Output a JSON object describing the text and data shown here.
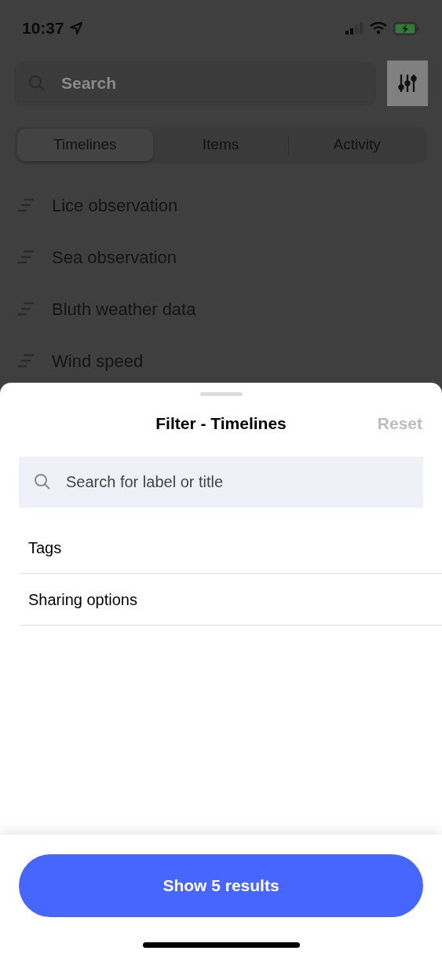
{
  "status_bar": {
    "time": "10:37"
  },
  "search": {
    "placeholder": "Search"
  },
  "tabs": [
    {
      "label": "Timelines",
      "selected": true
    },
    {
      "label": "Items",
      "selected": false
    },
    {
      "label": "Activity",
      "selected": false
    }
  ],
  "timelines": [
    "Lice observation",
    "Sea observation",
    "Bluth weather data",
    "Wind speed"
  ],
  "sheet": {
    "title": "Filter - Timelines",
    "reset": {
      "label": "Reset",
      "disabled": true
    },
    "search": {
      "placeholder": "Search for label or title"
    },
    "filters": [
      "Tags",
      "Sharing options"
    ],
    "button": "Show 5 results"
  }
}
